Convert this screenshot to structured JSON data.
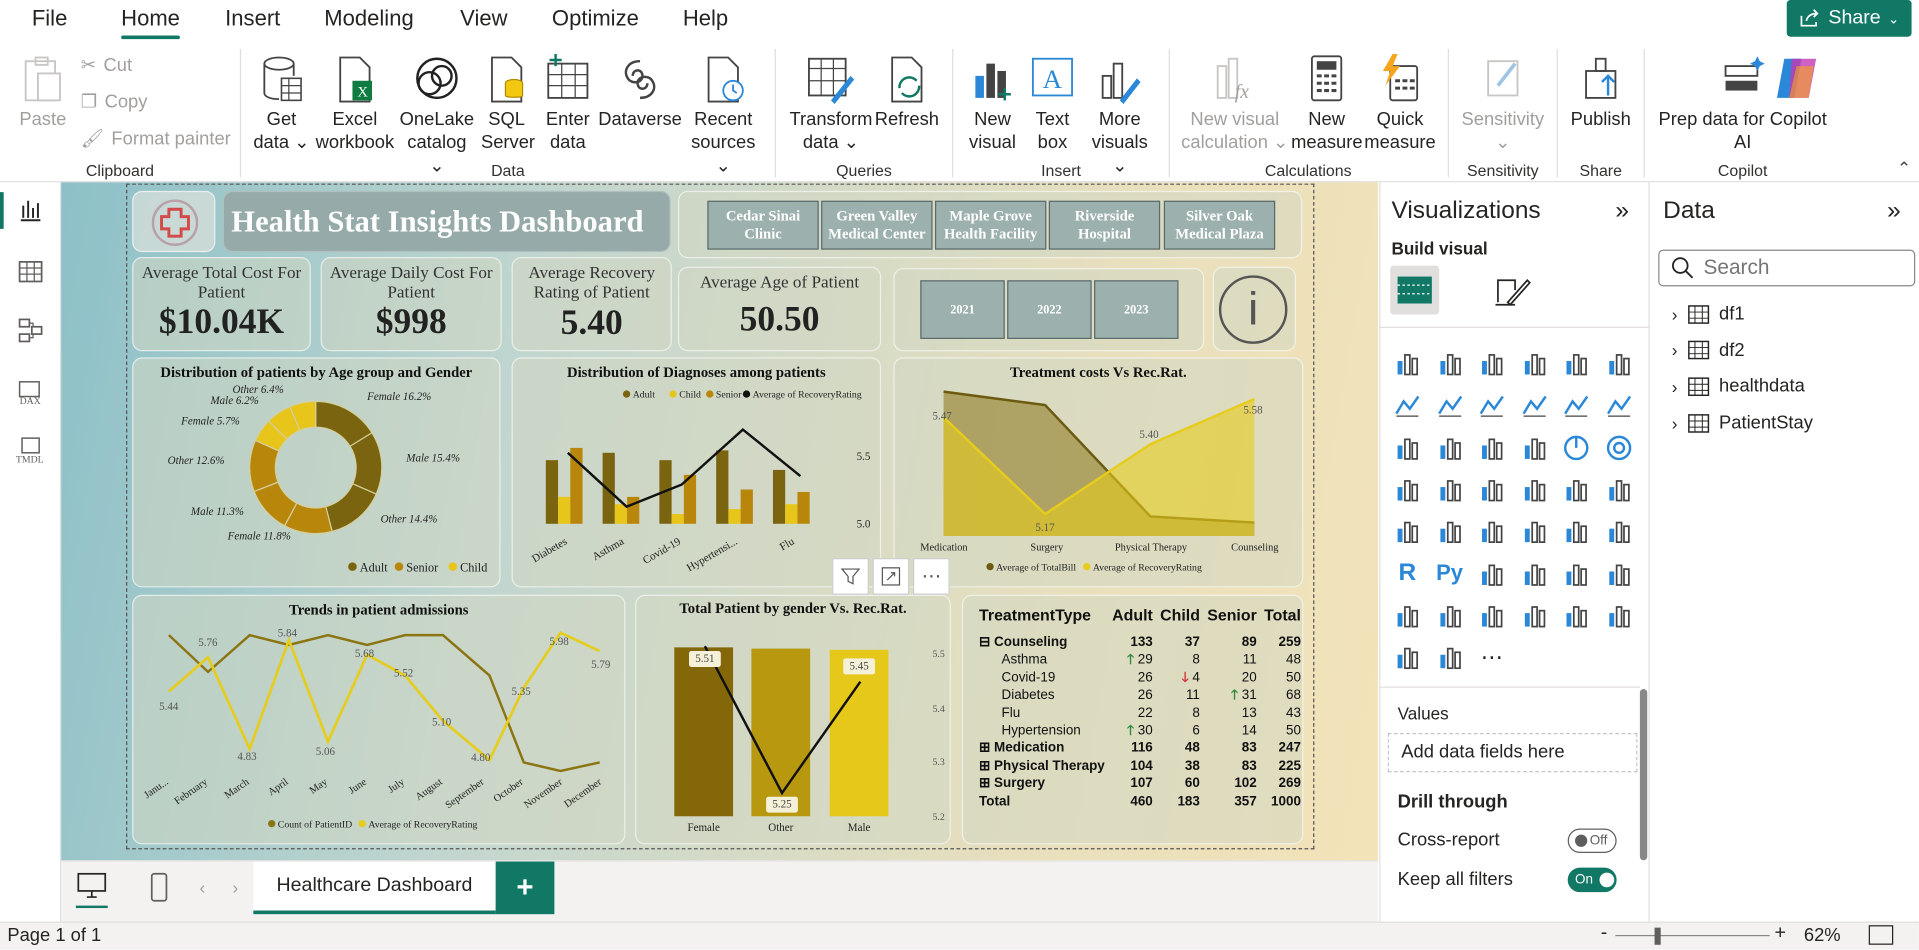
{
  "menu": {
    "file": "File",
    "home": "Home",
    "insert": "Insert",
    "modeling": "Modeling",
    "view": "View",
    "optimize": "Optimize",
    "help": "Help",
    "share": "Share"
  },
  "ribbon": {
    "paste": "Paste",
    "cut": "Cut",
    "copy": "Copy",
    "format_painter": "Format painter",
    "get_data": "Get",
    "get_data2": "data",
    "excel": "Excel",
    "excel2": "workbook",
    "onelake": "OneLake",
    "onelake2": "catalog",
    "sql": "SQL",
    "sql2": "Server",
    "enter": "Enter",
    "enter2": "data",
    "dataverse": "Dataverse",
    "recent": "Recent",
    "recent2": "sources",
    "transform": "Transform",
    "transform2": "data",
    "refresh": "Refresh",
    "new_visual": "New",
    "new_visual2": "visual",
    "text_box": "Text",
    "text_box2": "box",
    "more_visuals": "More",
    "more_visuals2": "visuals",
    "new_visual_calc": "New visual",
    "new_visual_calc2": "calculation",
    "new_measure": "New",
    "new_measure2": "measure",
    "quick_measure": "Quick",
    "quick_measure2": "measure",
    "sensitivity": "Sensitivity",
    "publish": "Publish",
    "prep_copilot": "Prep data for Copilot",
    "prep_copilot2": "AI",
    "groups": {
      "clipboard": "Clipboard",
      "data": "Data",
      "queries": "Queries",
      "insert": "Insert",
      "calculations": "Calculations",
      "sensitivity": "Sensitivity",
      "share": "Share",
      "copilot": "Copilot"
    }
  },
  "dashboard": {
    "title": "Health Stat Insights Dashboard",
    "hospitals": [
      "Cedar Sinai Clinic",
      "Green Valley Medical Center",
      "Maple Grove Health Facility",
      "Riverside Hospital",
      "Silver Oak Medical Plaza"
    ],
    "years": [
      "2021",
      "2022",
      "2023"
    ],
    "info": "i",
    "kpis": [
      {
        "title": "Average Total Cost For Patient",
        "value": "$10.04K"
      },
      {
        "title": "Average Daily Cost For Patient",
        "value": "$998"
      },
      {
        "title": "Average Recovery Rating of Patient",
        "value": "5.40"
      },
      {
        "title": "Average Age of Patient",
        "value": "50.50"
      }
    ]
  },
  "chart_data": [
    {
      "type": "pie",
      "title": "Distribution of patients by Age group and Gender",
      "labels": [
        "Female 16.2%",
        "Male 15.4%",
        "Other 14.4%",
        "Female 11.8%",
        "Male 11.3%",
        "Other 12.6%",
        "Female 5.7%",
        "Male 6.2%",
        "Other 6.4%"
      ],
      "values": [
        16.2,
        15.4,
        14.4,
        11.8,
        11.3,
        12.6,
        5.7,
        6.2,
        6.4
      ],
      "groups": [
        "Adult",
        "Adult",
        "Adult",
        "Senior",
        "Senior",
        "Senior",
        "Child",
        "Child",
        "Child"
      ],
      "legend": [
        "Adult",
        "Senior",
        "Child"
      ]
    },
    {
      "type": "bar",
      "title": "Distribution of Diagnoses among patients",
      "categories": [
        "Diabetes",
        "Asthma",
        "Covid-19",
        "Hypertensi...",
        "Flu"
      ],
      "legend": [
        "Adult",
        "Child",
        "Senior",
        "Average of RecoveryRating"
      ],
      "series": [
        {
          "name": "Adult",
          "values": [
            26,
            29,
            26,
            30,
            22
          ]
        },
        {
          "name": "Child",
          "values": [
            11,
            8,
            4,
            6,
            8
          ]
        },
        {
          "name": "Senior",
          "values": [
            31,
            11,
            20,
            14,
            13
          ]
        },
        {
          "name": "Average of RecoveryRating",
          "values": [
            5.45,
            5.21,
            5.28,
            5.5,
            5.35
          ]
        }
      ],
      "y2ticks": [
        "5.5",
        "5.0"
      ]
    },
    {
      "type": "area",
      "title": "Treatment costs Vs Rec.Rat.",
      "categories": [
        "Medication",
        "Surgery",
        "Physical Therapy",
        "Counseling"
      ],
      "legend": [
        "Average of TotalBill",
        "Average of RecoveryRating"
      ],
      "series": [
        {
          "name": "Average of TotalBill",
          "values": [
            15,
            14,
            3,
            2.5
          ]
        },
        {
          "name": "Average of RecoveryRating",
          "values": [
            5.47,
            5.17,
            5.4,
            5.58
          ]
        }
      ],
      "labels": [
        "5.47",
        "5.17",
        "5.40",
        "5.58"
      ]
    },
    {
      "type": "line",
      "title": "Trends in patient admissions",
      "categories": [
        "Janu...",
        "February",
        "March",
        "April",
        "May",
        "June",
        "July",
        "August",
        "September",
        "October",
        "November",
        "December"
      ],
      "legend": [
        "Count of PatientID",
        "Average of RecoveryRating"
      ],
      "series": [
        {
          "name": "Count of PatientID",
          "values": [
            90,
            80,
            90,
            88,
            90,
            88,
            90,
            90,
            80,
            20,
            18,
            20
          ]
        },
        {
          "name": "Average of RecoveryRating",
          "values": [
            5.44,
            5.76,
            4.83,
            5.84,
            5.06,
            5.68,
            5.52,
            5.1,
            4.8,
            5.35,
            5.98,
            5.79
          ]
        }
      ],
      "labels": [
        "5.44",
        "5.76",
        "4.83",
        "5.84",
        "5.06",
        "5.68",
        "5.52",
        "5.10",
        "4.80",
        "5.35",
        "5.98",
        "5.79"
      ]
    },
    {
      "type": "bar",
      "title": "Total Patient by gender Vs. Rec.Rat.",
      "categories": [
        "Female",
        "Other",
        "Male"
      ],
      "series": [
        {
          "name": "Total Patient",
          "values": [
            340,
            333,
            327
          ]
        },
        {
          "name": "Average of RecoveryRating",
          "values": [
            5.51,
            5.25,
            5.45
          ]
        }
      ],
      "labels": [
        "5.51",
        "5.25",
        "5.45"
      ],
      "y2ticks": [
        "5.5",
        "5.4",
        "5.3",
        "5.2"
      ]
    }
  ],
  "matrix": {
    "headers": [
      "TreatmentType",
      "Adult",
      "Child",
      "Senior",
      "Total"
    ],
    "rows": [
      {
        "label": "Counseling",
        "cells": [
          "133",
          "37",
          "89",
          "259"
        ],
        "bold": true,
        "expander": "⊟"
      },
      {
        "label": "Asthma",
        "cells": [
          "29",
          "8",
          "11",
          "48"
        ],
        "arrowAdult": "up"
      },
      {
        "label": "Covid-19",
        "cells": [
          "26",
          "4",
          "20",
          "50"
        ],
        "arrowChild": "down"
      },
      {
        "label": "Diabetes",
        "cells": [
          "26",
          "11",
          "31",
          "68"
        ],
        "arrowSenior": "up"
      },
      {
        "label": "Flu",
        "cells": [
          "22",
          "8",
          "13",
          "43"
        ]
      },
      {
        "label": "Hypertension",
        "cells": [
          "30",
          "6",
          "14",
          "50"
        ],
        "arrowAdult": "up"
      },
      {
        "label": "Medication",
        "cells": [
          "116",
          "48",
          "83",
          "247"
        ],
        "bold": true,
        "expander": "⊞"
      },
      {
        "label": "Physical Therapy",
        "cells": [
          "104",
          "38",
          "83",
          "225"
        ],
        "bold": true,
        "expander": "⊞"
      },
      {
        "label": "Surgery",
        "cells": [
          "107",
          "60",
          "102",
          "269"
        ],
        "bold": true,
        "expander": "⊞"
      },
      {
        "label": "Total",
        "cells": [
          "460",
          "183",
          "357",
          "1000"
        ],
        "bold": true
      }
    ]
  },
  "viz": {
    "title": "Visualizations",
    "build": "Build visual",
    "values": "Values",
    "add_fields": "Add data fields here",
    "drill": "Drill through",
    "cross_report": "Cross-report",
    "keep_filters": "Keep all filters",
    "off": "Off",
    "on": "On"
  },
  "data": {
    "title": "Data",
    "search_placeholder": "Search",
    "tables": [
      "df1",
      "df2",
      "healthdata",
      "PatientStay"
    ]
  },
  "pages": {
    "tab": "Healthcare Dashboard",
    "add": "+"
  },
  "status": {
    "page": "Page 1 of 1",
    "zoom": "62%",
    "minus": "-",
    "plus": "+"
  }
}
